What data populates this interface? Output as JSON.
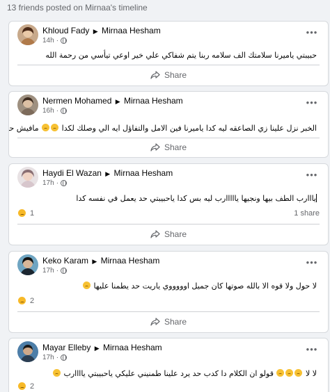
{
  "header": {
    "title": "13 friends posted on Mirnaa's timeline"
  },
  "posts": [
    {
      "author": "Khloud Fady",
      "target": "Mirnaa Hesham",
      "time": "14h",
      "text": "حبيبتي ياميرنا سلامتك الف سلامه ربنا يتم شفاكي علي خير اوعي تيأسي من رحمة الله",
      "share_label": "Share"
    },
    {
      "author": "Nermen Mohamed",
      "target": "Mirnaa Hesham",
      "time": "16h",
      "text": "الخبر نزل علينا زي الصاعقه ليه كدا ياميرنا فين الامل والتفاؤل ايه الي وصلك لكدا",
      "text_after": "مافيش حاجه تستاهل صدقيني",
      "share_label": "Share"
    },
    {
      "author": "Haydi El Wazan",
      "target": "Mirnaa Hesham",
      "time": "17h",
      "text": "يااارب الطف بيها ونجيها يااااارب ليه بس كدا ياحبيبتي حد يعمل في نفسه كدا",
      "reaction_count": "1",
      "shares": "1 share",
      "share_label": "Share"
    },
    {
      "author": "Keko Karam",
      "target": "Mirnaa Hesham",
      "time": "17h",
      "text": "لا حول ولا قوه الا بالله صوتها كان جميل اوووووي ياريت حد يطمنا عليها",
      "reaction_count": "2",
      "share_label": "Share"
    },
    {
      "author": "Mayar Elleby",
      "target": "Mirnaa Hesham",
      "time": "17h",
      "text": "لا لا",
      "text_after": "قولو ان الكلام دا كدب حد يرد علينا طمنيني عليكي ياحبيبتي ياااارب",
      "reaction_count": "2",
      "share_label": "Share"
    }
  ],
  "colors": {
    "background": "#f0f2f5",
    "card": "#ffffff",
    "muted": "#65676b",
    "reaction": "#f7b928"
  },
  "icons": [
    "globe-icon",
    "more-icon",
    "share-icon",
    "sad-reaction-icon"
  ]
}
